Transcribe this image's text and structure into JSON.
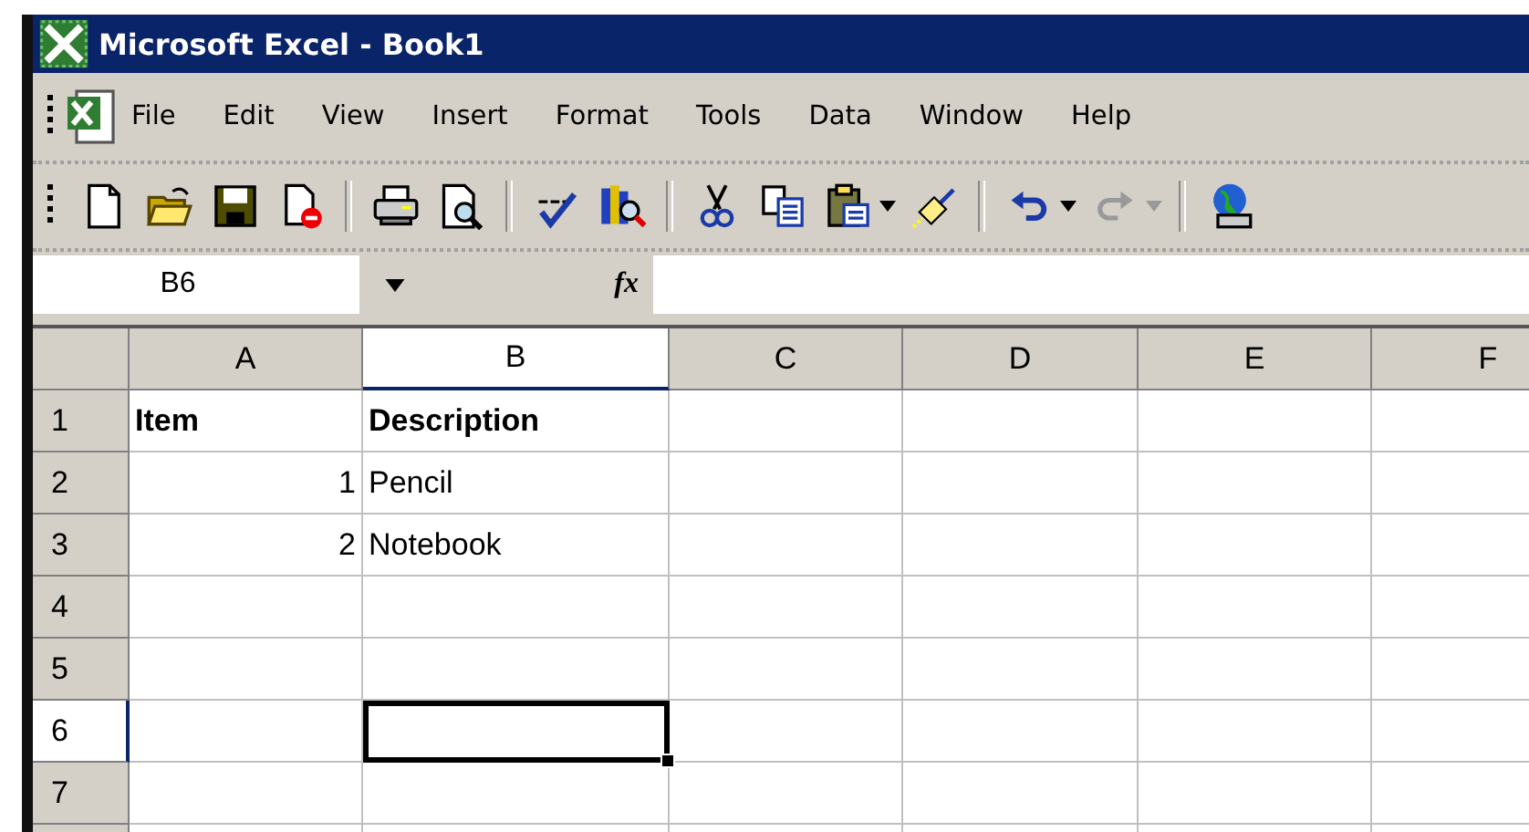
{
  "window": {
    "title": "Microsoft Excel - Book1"
  },
  "menu": [
    {
      "label": "File"
    },
    {
      "label": "Edit"
    },
    {
      "label": "View"
    },
    {
      "label": "Insert"
    },
    {
      "label": "Format"
    },
    {
      "label": "Tools"
    },
    {
      "label": "Data"
    },
    {
      "label": "Window"
    },
    {
      "label": "Help"
    }
  ],
  "toolbar": [
    {
      "kind": "new"
    },
    {
      "kind": "open"
    },
    {
      "kind": "save"
    },
    {
      "kind": "permission"
    },
    {
      "kind": "separator"
    },
    {
      "kind": "print"
    },
    {
      "kind": "preview"
    },
    {
      "kind": "separator"
    },
    {
      "kind": "spelling"
    },
    {
      "kind": "research"
    },
    {
      "kind": "separator"
    },
    {
      "kind": "cut"
    },
    {
      "kind": "copy"
    },
    {
      "kind": "paste"
    },
    {
      "kind": "dropdown"
    },
    {
      "kind": "painter"
    },
    {
      "kind": "separator"
    },
    {
      "kind": "undo",
      "disabled": false
    },
    {
      "kind": "dropdown",
      "disabled": false
    },
    {
      "kind": "redo",
      "disabled": true
    },
    {
      "kind": "dropdown",
      "disabled": true
    },
    {
      "kind": "separator"
    },
    {
      "kind": "globe"
    }
  ],
  "formula_bar": {
    "name_box": "B6",
    "function_label": "fx"
  },
  "sheet": {
    "columns": [
      {
        "label": "A",
        "selected": false
      },
      {
        "label": "B",
        "selected": true
      },
      {
        "label": "C",
        "selected": false
      },
      {
        "label": "D",
        "selected": false
      },
      {
        "label": "E",
        "selected": false
      },
      {
        "label": "F",
        "selected": false
      }
    ],
    "rows": [
      {
        "label": "1",
        "selected": false,
        "cells": [
          {
            "text": "Item",
            "kind": "text",
            "bold": true,
            "selected": false
          },
          {
            "text": "Description",
            "kind": "text",
            "bold": true,
            "selected": false
          },
          {
            "selected": false
          },
          {
            "selected": false
          },
          {
            "selected": false
          },
          {
            "selected": false
          }
        ]
      },
      {
        "label": "2",
        "selected": false,
        "cells": [
          {
            "text": "1",
            "kind": "number",
            "bold": false,
            "selected": false
          },
          {
            "text": "Pencil",
            "kind": "text",
            "bold": false,
            "selected": false
          },
          {
            "selected": false
          },
          {
            "selected": false
          },
          {
            "selected": false
          },
          {
            "selected": false
          }
        ]
      },
      {
        "label": "3",
        "selected": false,
        "cells": [
          {
            "text": "2",
            "kind": "number",
            "bold": false,
            "selected": false
          },
          {
            "text": "Notebook",
            "kind": "text",
            "bold": false,
            "selected": false
          },
          {
            "selected": false
          },
          {
            "selected": false
          },
          {
            "selected": false
          },
          {
            "selected": false
          }
        ]
      },
      {
        "label": "4",
        "selected": false,
        "cells": [
          {
            "selected": false
          },
          {
            "selected": false
          },
          {
            "selected": false
          },
          {
            "selected": false
          },
          {
            "selected": false
          },
          {
            "selected": false
          }
        ]
      },
      {
        "label": "5",
        "selected": false,
        "cells": [
          {
            "selected": false
          },
          {
            "selected": false
          },
          {
            "selected": false
          },
          {
            "selected": false
          },
          {
            "selected": false
          },
          {
            "selected": false
          }
        ]
      },
      {
        "label": "6",
        "selected": true,
        "cells": [
          {
            "selected": false
          },
          {
            "selected": true
          },
          {
            "selected": false
          },
          {
            "selected": false
          },
          {
            "selected": false
          },
          {
            "selected": false
          }
        ]
      },
      {
        "label": "7",
        "selected": false,
        "cells": [
          {
            "selected": false
          },
          {
            "selected": false
          },
          {
            "selected": false
          },
          {
            "selected": false
          },
          {
            "selected": false
          },
          {
            "selected": false
          }
        ]
      }
    ]
  }
}
